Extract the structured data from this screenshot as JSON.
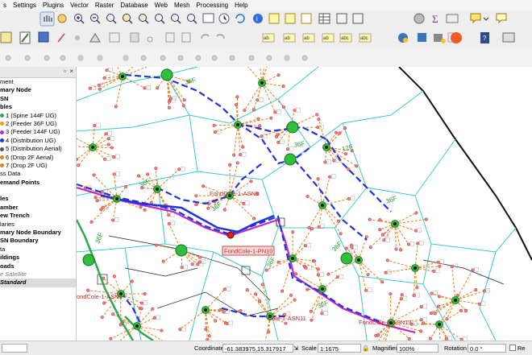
{
  "menu": [
    "s",
    "Settings",
    "Plugins",
    "Vector",
    "Raster",
    "Database",
    "Web",
    "Mesh",
    "Processing",
    "Help"
  ],
  "layers_panel": {
    "items": [
      {
        "label": "ment",
        "style": "plain"
      },
      {
        "label": "mary Node",
        "style": "bold"
      },
      {
        "label": "SN",
        "style": "bold"
      },
      {
        "label": "bles",
        "style": "bold"
      },
      {
        "label": "1 (Spine 144F UG)",
        "style": "plain",
        "color": "#2fa84f"
      },
      {
        "label": "2 (Feeder 36F UG)",
        "style": "plain",
        "color": "#e8a010"
      },
      {
        "label": "3 (Feeder 144F UG)",
        "style": "plain",
        "color": "#c02bc0"
      },
      {
        "label": "4 (Distribution UG)",
        "style": "plain",
        "color": "#2233dd"
      },
      {
        "label": "5 (Distribution Aerial)",
        "style": "plain",
        "color": "#555555"
      },
      {
        "label": "6 (Drop 2F Aerial)",
        "style": "plain",
        "color": "#e8801a"
      },
      {
        "label": "7 (Drop 2F UG)",
        "style": "plain",
        "color": "#e8801a"
      },
      {
        "label": "ss Data",
        "style": "plain"
      },
      {
        "label": "emand Points",
        "style": "bold"
      },
      {
        "label": "",
        "style": "plain"
      },
      {
        "label": "les",
        "style": "bold"
      },
      {
        "label": "amber",
        "style": "bold"
      },
      {
        "label": "ew Trench",
        "style": "bold"
      },
      {
        "label": "laries",
        "style": "plain"
      },
      {
        "label": "mary Node Boundary",
        "style": "bold"
      },
      {
        "label": "SN Boundary",
        "style": "bold"
      },
      {
        "label": "ta",
        "style": "plain"
      },
      {
        "label": "ildings",
        "style": "bold"
      },
      {
        "label": "oads",
        "style": "bold"
      },
      {
        "label": "e Satellite",
        "style": "italic"
      },
      {
        "label": "Standard",
        "style": "selected"
      }
    ]
  },
  "map_labels": {
    "asn2": "FondCole-1-ASN2",
    "pn10": "FondCole-1-PN10",
    "asn1": "ondCole-1-ASN1",
    "asn11": "Cole-1-ASN11",
    "asn13": "FondCole-1-ASN13",
    "fiber_36f": "36F",
    "fiber_12f": "12F"
  },
  "statusbar": {
    "coordinate_label": "Coordinate",
    "coordinate_value": "-61.383975,15.317917",
    "scale_label": "Scale",
    "scale_value": "1:1675",
    "magnifier_label": "Magnifier",
    "magnifier_value": "100%",
    "rotation_label": "Rotation",
    "rotation_value": "0.0 °",
    "render_label": "Re"
  },
  "colors": {
    "spine": "#2fa84f",
    "feeder": "#2233dd",
    "feeder144": "#c02bc0",
    "drop": "#e8801a",
    "boundary": "#3cc8c8",
    "node": "#2fbf3a"
  }
}
